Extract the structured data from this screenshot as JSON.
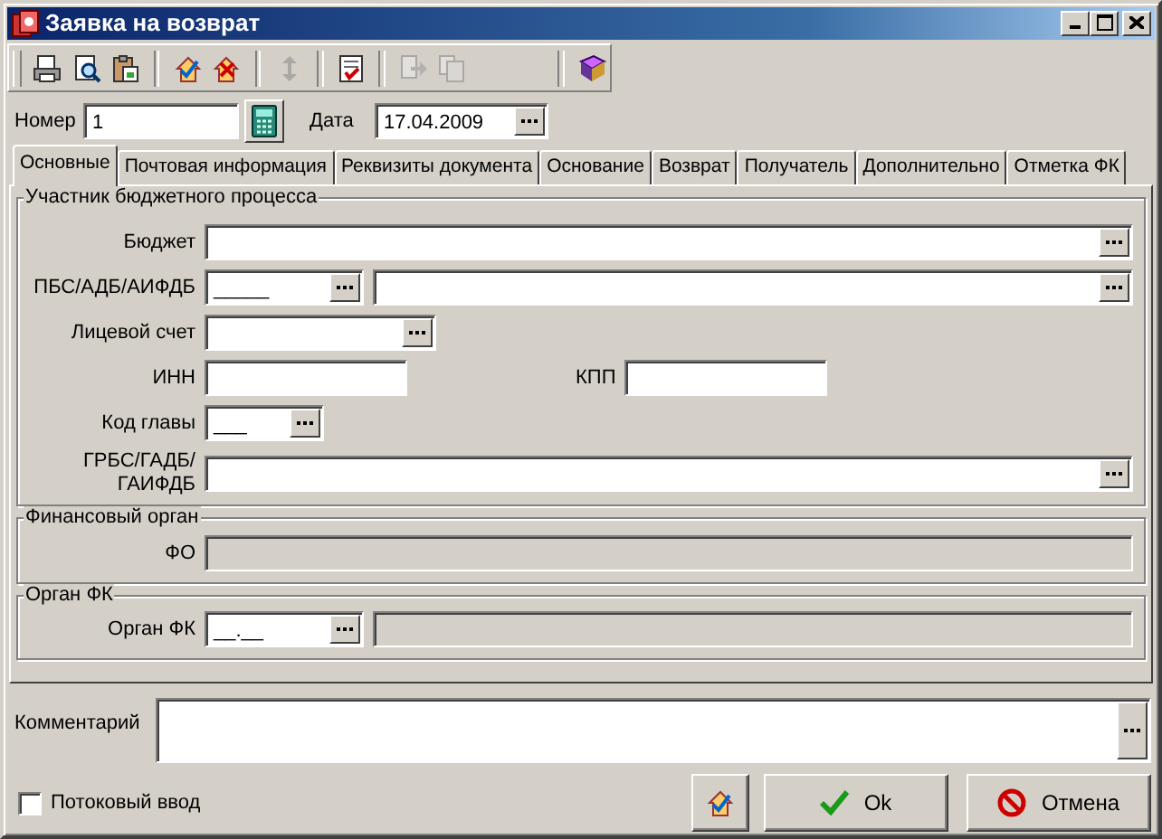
{
  "window": {
    "title": "Заявка на возврат"
  },
  "toolbar": [
    {
      "kind": "print",
      "disabled": false
    },
    {
      "kind": "preview",
      "disabled": false
    },
    {
      "kind": "paste",
      "disabled": false
    },
    {
      "kind": "separator"
    },
    {
      "kind": "accept",
      "disabled": false
    },
    {
      "kind": "reject",
      "disabled": false
    },
    {
      "kind": "separator"
    },
    {
      "kind": "exchange",
      "disabled": true
    },
    {
      "kind": "separator"
    },
    {
      "kind": "checklist",
      "disabled": false
    },
    {
      "kind": "separator"
    },
    {
      "kind": "forward",
      "disabled": true
    },
    {
      "kind": "copies",
      "disabled": true
    },
    {
      "kind": "gap"
    },
    {
      "kind": "separator"
    },
    {
      "kind": "help",
      "disabled": false
    }
  ],
  "header": {
    "number": {
      "label": "Номер",
      "value": "1"
    },
    "date": {
      "label": "Дата",
      "value": "17.04.2009"
    }
  },
  "tabs": [
    {
      "label": "Основные",
      "selected": true
    },
    {
      "label": "Почтовая информация",
      "selected": false
    },
    {
      "label": "Реквизиты документа",
      "selected": false
    },
    {
      "label": "Основание",
      "selected": false
    },
    {
      "label": "Возврат",
      "selected": false
    },
    {
      "label": "Получатель",
      "selected": false
    },
    {
      "label": "Дополнительно",
      "selected": false
    },
    {
      "label": "Отметка ФК",
      "selected": false
    }
  ],
  "participant": {
    "title": "Участник бюджетного процесса",
    "budget": {
      "label": "Бюджет"
    },
    "pbs": {
      "label": "ПБС/АДБ/АИФДБ",
      "code": "_____"
    },
    "account": {
      "label": "Лицевой счет"
    },
    "inn": {
      "label": "ИНН"
    },
    "kpp": {
      "label": "КПП"
    },
    "chapter": {
      "label": "Код главы",
      "value": "___"
    },
    "grbs": {
      "label": "ГРБС/ГАДБ/ ГАИФДБ"
    }
  },
  "finance": {
    "title": "Финансовый орган",
    "fo": {
      "label": "ФО",
      "disabled": true
    }
  },
  "fk": {
    "title": "Орган ФК",
    "label": "Орган ФК",
    "code": "__.__",
    "name_disabled": true
  },
  "comment": {
    "label": "Комментарий"
  },
  "stream_input": {
    "label": "Потоковый ввод",
    "checked": false
  },
  "buttons": [
    {
      "kind": "icon"
    },
    {
      "kind": "ok",
      "label": "Ok"
    },
    {
      "kind": "cancel",
      "label": "Отмена"
    }
  ]
}
